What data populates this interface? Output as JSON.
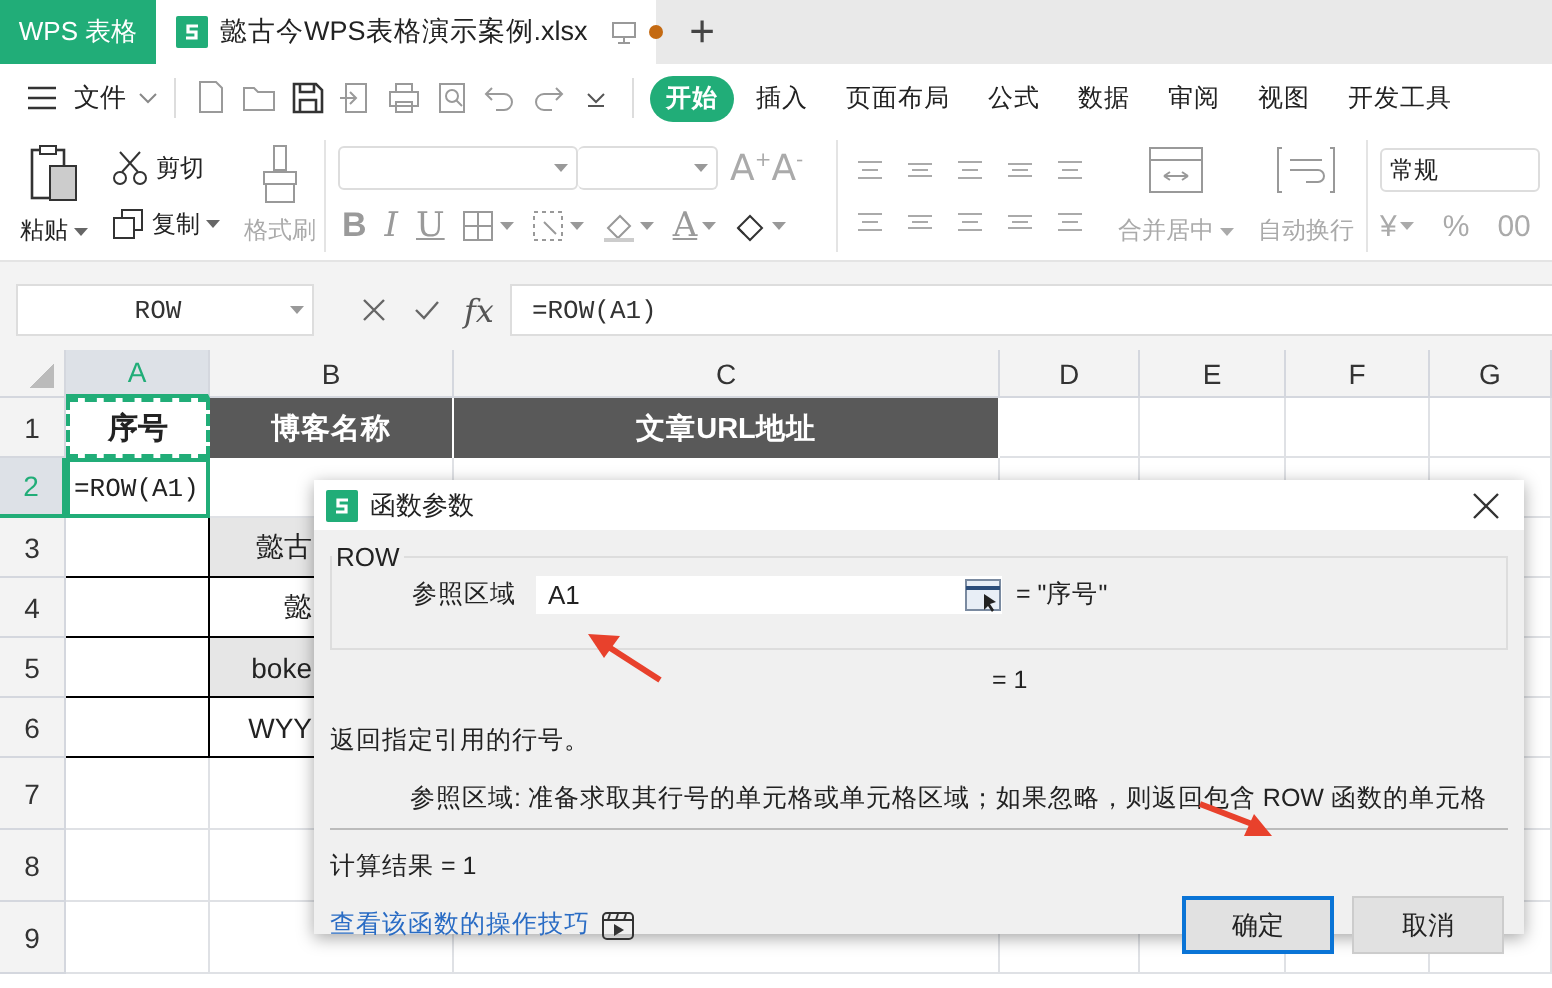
{
  "app_tab": {
    "label": "WPS 表格"
  },
  "doc_tabs": [
    {
      "title": "懿古今WPS表格演示案例.xlsx",
      "selected": true,
      "unsaved": true
    }
  ],
  "new_tab": {
    "label": "+"
  },
  "menu": {
    "file": "文件",
    "tabs": [
      {
        "label": "开始",
        "selected": true
      },
      {
        "label": "插入",
        "selected": false
      },
      {
        "label": "页面布局",
        "selected": false
      },
      {
        "label": "公式",
        "selected": false
      },
      {
        "label": "数据",
        "selected": false
      },
      {
        "label": "审阅",
        "selected": false
      },
      {
        "label": "视图",
        "selected": false
      },
      {
        "label": "开发工具",
        "selected": false
      }
    ]
  },
  "ribbon": {
    "clipboard": [
      {
        "kind": "paste",
        "label": "粘贴",
        "dropdown": true,
        "disabled": false
      },
      {
        "kind": "cut",
        "label": "剪切",
        "dropdown": false,
        "disabled": false
      },
      {
        "kind": "copy",
        "label": "复制",
        "dropdown": true,
        "disabled": false
      },
      {
        "kind": "painter",
        "label": "格式刷",
        "dropdown": false,
        "disabled": true
      }
    ],
    "size_buttons": [
      "A$^{+}$",
      "A$^{-}$"
    ],
    "format_buttons": [
      {
        "kind": "bold",
        "label": "B"
      },
      {
        "kind": "italic",
        "label": "I"
      },
      {
        "kind": "underline",
        "label": "U"
      },
      {
        "kind": "borders"
      },
      {
        "kind": "cell_style"
      },
      {
        "kind": "fill"
      },
      {
        "kind": "font_color",
        "label": "A"
      },
      {
        "kind": "clear"
      }
    ],
    "layout_buttons": [
      {
        "kind": "merge",
        "label": "合并居中",
        "dropdown": true,
        "disabled": true
      },
      {
        "kind": "wrap",
        "label": "自动换行",
        "dropdown": false,
        "disabled": true
      }
    ],
    "number_format": {
      "value": "常规"
    },
    "number_buttons": [
      {
        "label": "¥",
        "dropdown": true
      },
      {
        "label": "%",
        "dropdown": false
      },
      {
        "label": "00",
        "dropdown": false
      }
    ]
  },
  "formula_bar": {
    "name_box": "ROW",
    "fx": "fx",
    "formula": "=ROW(A1)"
  },
  "sheet": {
    "columns": [
      {
        "label": "A",
        "selected": true
      },
      {
        "label": "B",
        "selected": false
      },
      {
        "label": "C",
        "selected": false
      },
      {
        "label": "D",
        "selected": false
      },
      {
        "label": "E",
        "selected": false
      },
      {
        "label": "F",
        "selected": false
      },
      {
        "label": "G",
        "selected": false
      }
    ],
    "rows": [
      {
        "label": "1",
        "selected": false,
        "cells": [
          {
            "kind": "marquee",
            "text": "序号"
          },
          {
            "kind": "dark",
            "text": "博客名称"
          },
          {
            "kind": "dark",
            "text": "文章URL地址"
          }
        ]
      },
      {
        "label": "2",
        "selected": true,
        "cells": [
          {
            "kind": "editing",
            "text": "=ROW(A1)"
          }
        ]
      },
      {
        "label": "3",
        "selected": false,
        "cells": [
          {
            "kind": "bordered"
          },
          {
            "kind": "band",
            "text": "懿古"
          }
        ]
      },
      {
        "label": "4",
        "selected": false,
        "cells": [
          {
            "kind": "bordered"
          },
          {
            "kind": "bordered",
            "text": "懿"
          }
        ]
      },
      {
        "label": "5",
        "selected": false,
        "cells": [
          {
            "kind": "bordered"
          },
          {
            "kind": "band",
            "text": "boke"
          }
        ]
      },
      {
        "label": "6",
        "selected": false,
        "cells": [
          {
            "kind": "bordered"
          },
          {
            "kind": "bordered",
            "text": "WYY"
          }
        ]
      },
      {
        "label": "7",
        "selected": false
      },
      {
        "label": "8",
        "selected": false
      },
      {
        "label": "9",
        "selected": false
      }
    ]
  },
  "dialog": {
    "title": "函数参数",
    "function": "ROW",
    "arguments": [
      {
        "label": "参照区域",
        "value": "A1",
        "result": "= \"序号\""
      }
    ],
    "function_result": "= 1",
    "summary": "返回指定引用的行号。",
    "argument_help": "参照区域:  准备求取其行号的单元格或单元格区域；如果忽略，则返回包含 ROW 函数的单元格",
    "calc_result": "计算结果  =  1",
    "help_link": "查看该函数的操作技巧",
    "buttons": [
      {
        "label": "确定",
        "default": true
      },
      {
        "label": "取消",
        "default": false
      }
    ]
  }
}
